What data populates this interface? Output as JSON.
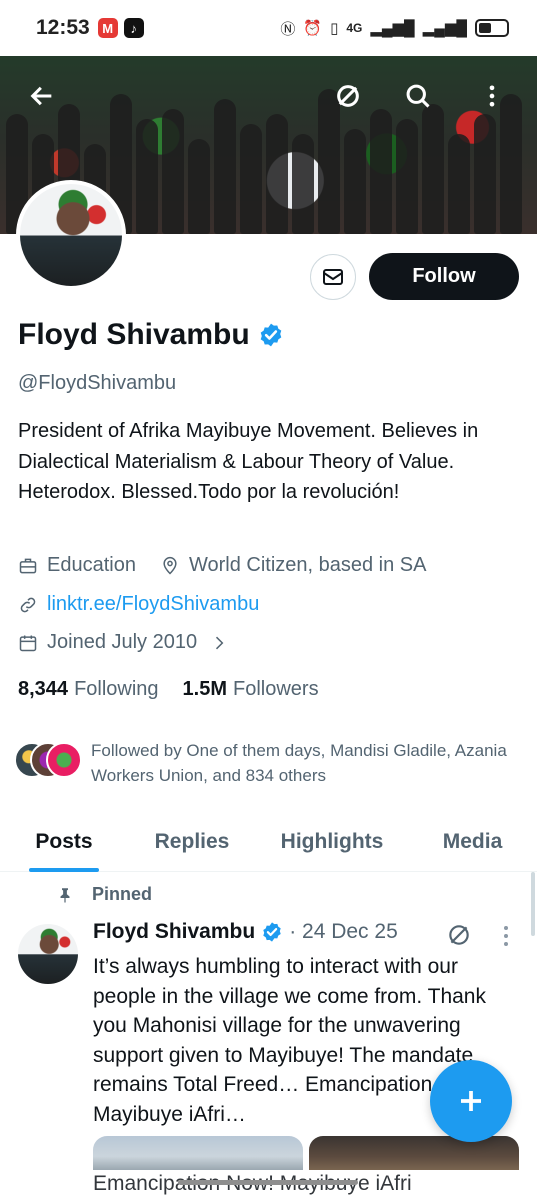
{
  "status_bar": {
    "time": "12:53",
    "network": "4G",
    "icons": [
      "nfc-icon",
      "alarm-icon",
      "vibrate-icon",
      "signal-icon",
      "battery-icon"
    ]
  },
  "header": {
    "icons": [
      "back-arrow-icon",
      "grok-icon",
      "search-icon",
      "more-vertical-icon"
    ]
  },
  "profile": {
    "name": "Floyd Shivambu",
    "handle": "@FloydShivambu",
    "verified": true,
    "bio": "President of Afrika Mayibuye Movement. Believes in Dialectical Materialism & Labour Theory of Value. Heterodox. Blessed.Todo por la revolución!",
    "category": "Education",
    "location": "World Citizen, based in SA",
    "link": "linktr.ee/FloydShivambu",
    "joined": "Joined July 2010",
    "following_count": "8,344",
    "following_label": "Following",
    "followers_count": "1.5M",
    "followers_label": "Followers",
    "followed_by": "Followed by One of them days, Mandisi Gladile, Azania Workers Union, and 834 others",
    "follow_label": "Follow"
  },
  "tabs": [
    {
      "label": "Posts",
      "active": true
    },
    {
      "label": "Replies",
      "active": false
    },
    {
      "label": "Highlights",
      "active": false
    },
    {
      "label": "Media",
      "active": false
    }
  ],
  "pinned_tweet": {
    "pinned_label": "Pinned",
    "author": "Floyd Shivambu",
    "date": "· 24 Dec 25",
    "text": "It’s always humbling to interact with our people in the village we come from. Thank you Mahonisi village for the unwavering support given to Mayibuye! The mandate remains Total Freed… Emancipation Now! Mayibuye iAfri…",
    "ghost_line": "Emancipation Now! Mayibuye iAfri"
  },
  "colors": {
    "accent": "#1d9bf0",
    "text_primary": "#0f1419",
    "text_secondary": "#536471",
    "follow_button": "#0f1419"
  }
}
